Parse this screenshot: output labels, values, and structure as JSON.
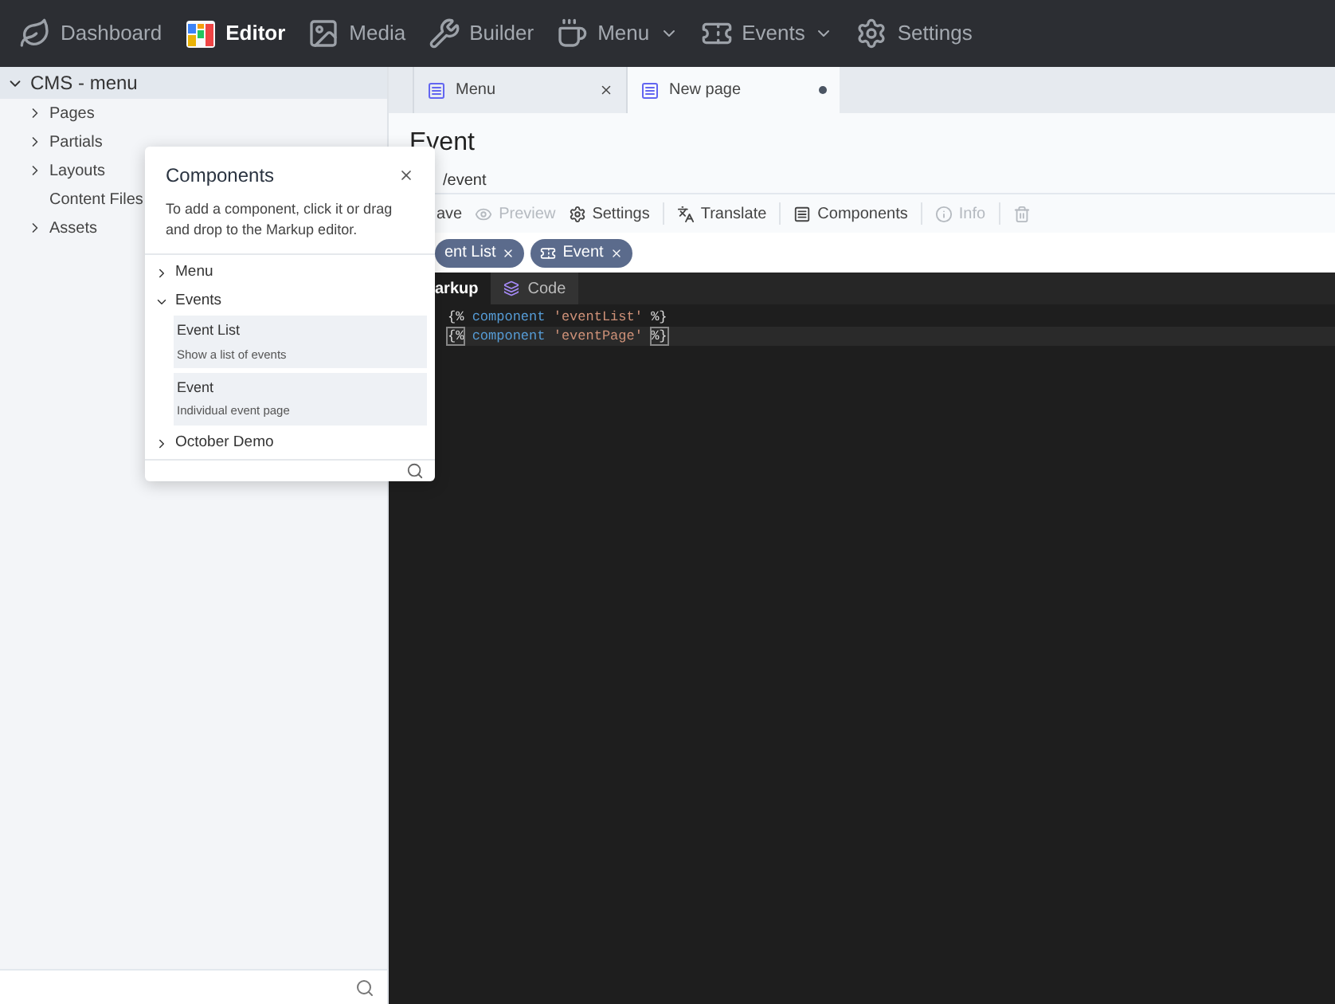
{
  "nav": [
    {
      "label": "Dashboard",
      "kind": "leaf",
      "selected": false,
      "dropdown": false
    },
    {
      "label": "Editor",
      "kind": "editor",
      "selected": true,
      "dropdown": false
    },
    {
      "label": "Media",
      "kind": "media",
      "selected": false,
      "dropdown": false
    },
    {
      "label": "Builder",
      "kind": "tools",
      "selected": false,
      "dropdown": false
    },
    {
      "label": "Menu",
      "kind": "cup",
      "selected": false,
      "dropdown": true
    },
    {
      "label": "Events",
      "kind": "ticket",
      "selected": false,
      "dropdown": true
    },
    {
      "label": "Settings",
      "kind": "gear",
      "selected": false,
      "dropdown": false
    }
  ],
  "sidebar": {
    "title": "CMS - menu",
    "expanded": true,
    "items": [
      {
        "label": "Pages",
        "expandable": true
      },
      {
        "label": "Partials",
        "expandable": true
      },
      {
        "label": "Layouts",
        "expandable": true
      },
      {
        "label": "Content Files",
        "expandable": false
      },
      {
        "label": "Assets",
        "expandable": true
      }
    ]
  },
  "tabs": [
    {
      "label": "Menu",
      "selected": false,
      "modified": false
    },
    {
      "label": "New page",
      "selected": true,
      "modified": true
    }
  ],
  "page": {
    "title": "Event",
    "url": "/event"
  },
  "toolbar": [
    {
      "label": "ave",
      "kind": "save",
      "disabled": false
    },
    {
      "label": "Preview",
      "kind": "preview",
      "disabled": true
    },
    {
      "label": "Settings",
      "kind": "settings",
      "disabled": false
    },
    {
      "label": "Translate",
      "kind": "translate",
      "disabled": false
    },
    {
      "label": "Components",
      "kind": "components",
      "disabled": false
    },
    {
      "label": "Info",
      "kind": "info",
      "disabled": true
    },
    {
      "kind": "trash",
      "disabled": true
    }
  ],
  "chips": [
    "ent List",
    "Event"
  ],
  "editor_tabs": [
    {
      "label": "arkup",
      "selected": true
    },
    {
      "label": "Code",
      "selected": false
    }
  ],
  "code": [
    {
      "open": "{%",
      "keyword": "component",
      "string": "'eventList'",
      "close": "%}",
      "cursor": false
    },
    {
      "open": "{%",
      "keyword": "component",
      "string": "'eventPage'",
      "close": "%}",
      "cursor": true
    }
  ],
  "popup": {
    "title": "Components",
    "description": "To add a component, click it or drag and drop to the Markup editor.",
    "groups": [
      {
        "label": "Menu",
        "expanded": false
      },
      {
        "label": "Events",
        "expanded": true,
        "items": [
          {
            "title": "Event List",
            "description": "Show a list of events"
          },
          {
            "title": "Event",
            "description": "Individual event page"
          }
        ]
      },
      {
        "label": "October Demo",
        "expanded": false
      }
    ]
  }
}
